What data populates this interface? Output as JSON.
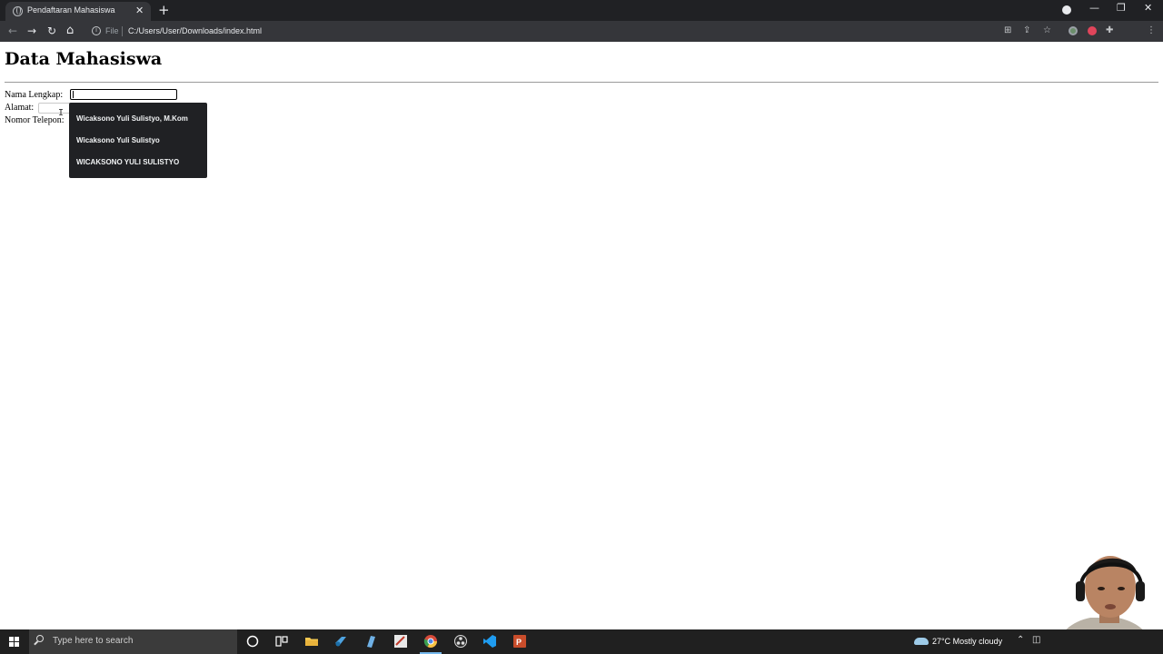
{
  "browser": {
    "tab_title": "Pendaftaran Mahasiswa",
    "tab_close": "✕",
    "new_tab": "+",
    "address": {
      "scheme_label": "File",
      "url": "C:/Users/User/Downloads/index.html"
    },
    "window_controls": {
      "minimize": "—",
      "maximize": "❐",
      "close": "✕"
    },
    "nav": {
      "back": "←",
      "forward": "→",
      "reload": "↻",
      "home": "⌂"
    },
    "toolbar_icons": {
      "translate": "⊞",
      "share": "⇪",
      "bookmark": "☆",
      "extensions": "✚",
      "menu": "⋮"
    }
  },
  "page": {
    "heading": "Data Mahasiswa",
    "form": {
      "nama_label": "Nama Lengkap:",
      "nama_value": "",
      "alamat_label": "Alamat:",
      "alamat_value": "",
      "telepon_label": "Nomor Telepon:",
      "telepon_value": ""
    },
    "autofill_suggestions": [
      "Wicaksono Yuli Sulistyo, M.Kom",
      "Wicaksono Yuli Sulistyo",
      "WICAKSONO YULI SULISTYO"
    ]
  },
  "taskbar": {
    "search_placeholder": "Type here to search",
    "weather": "27°C  Mostly cloudy",
    "apps": [
      "cortana-icon",
      "task-view-icon",
      "file-explorer-icon",
      "steam-icon",
      "notepad-icon",
      "paint-icon",
      "chrome-icon",
      "obs-icon",
      "vscode-icon",
      "powerpoint-icon"
    ],
    "accent_color": "#76b9ed"
  }
}
